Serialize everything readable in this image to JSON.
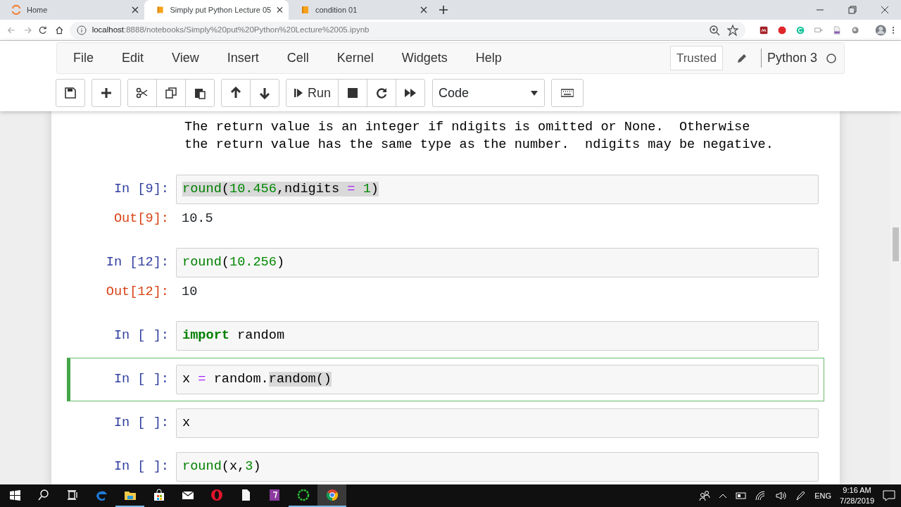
{
  "browser": {
    "tabs": [
      {
        "label": "Home",
        "selected": false
      },
      {
        "label": "Simply put Python Lecture 05",
        "selected": true
      },
      {
        "label": "condition 01",
        "selected": false
      }
    ],
    "address": {
      "host": "localhost",
      "path": ":8888/notebooks/Simply%20put%20Python%20Lecture%2005.ipynb"
    }
  },
  "jupyter": {
    "menu": [
      "File",
      "Edit",
      "View",
      "Insert",
      "Cell",
      "Kernel",
      "Widgets",
      "Help"
    ],
    "trusted": "Trusted",
    "kernel": "Python 3",
    "kernel_busy": false,
    "run_label": "Run",
    "cell_type": "Code"
  },
  "cells": [
    {
      "kind": "markdown",
      "lines": [
        "The return value is an integer if ndigits is omitted or None.  Otherwise",
        "the return value has the same type as the number.  ndigits may be negative."
      ]
    },
    {
      "kind": "code",
      "prompt": "In [9]:",
      "selected": false,
      "tokens": [
        {
          "text": "round",
          "kind": "builtin",
          "highlight": true
        },
        {
          "text": "(",
          "kind": "plain",
          "highlight": true
        },
        {
          "text": "10.456",
          "kind": "number",
          "highlight": true
        },
        {
          "text": ",ndigits ",
          "kind": "plain",
          "highlight": true
        },
        {
          "text": "=",
          "kind": "operator",
          "highlight": true
        },
        {
          "text": " 1",
          "kind": "number",
          "highlight": true
        },
        {
          "text": ")",
          "kind": "plain",
          "highlight": true
        }
      ],
      "output": {
        "prompt": "Out[9]:",
        "text": "10.5"
      }
    },
    {
      "kind": "code",
      "prompt": "In [12]:",
      "selected": false,
      "tokens": [
        {
          "text": "round",
          "kind": "builtin",
          "highlight": false
        },
        {
          "text": "(",
          "kind": "plain",
          "highlight": false
        },
        {
          "text": "10.256",
          "kind": "number",
          "highlight": false
        },
        {
          "text": ")",
          "kind": "plain",
          "highlight": false
        }
      ],
      "output": {
        "prompt": "Out[12]:",
        "text": "10"
      }
    },
    {
      "kind": "code",
      "prompt": "In [ ]:",
      "selected": false,
      "tokens": [
        {
          "text": "import",
          "kind": "keyword",
          "highlight": false
        },
        {
          "text": " random",
          "kind": "plain",
          "highlight": false
        }
      ]
    },
    {
      "kind": "code",
      "prompt": "In [ ]:",
      "selected": true,
      "tokens": [
        {
          "text": "x ",
          "kind": "plain",
          "highlight": false
        },
        {
          "text": "=",
          "kind": "operator",
          "highlight": false
        },
        {
          "text": " random.",
          "kind": "plain",
          "highlight": false
        },
        {
          "text": "random()",
          "kind": "plain",
          "highlight": true
        }
      ]
    },
    {
      "kind": "code",
      "prompt": "In [ ]:",
      "selected": false,
      "tokens": [
        {
          "text": "x",
          "kind": "plain",
          "highlight": false
        }
      ]
    },
    {
      "kind": "code",
      "prompt": "In [ ]:",
      "selected": false,
      "tokens": [
        {
          "text": "round",
          "kind": "builtin",
          "highlight": false
        },
        {
          "text": "(x,",
          "kind": "plain",
          "highlight": false
        },
        {
          "text": "3",
          "kind": "number",
          "highlight": false
        },
        {
          "text": ")",
          "kind": "plain",
          "highlight": false
        }
      ]
    }
  ],
  "taskbar": {
    "apps": [
      {
        "kind": "start",
        "running": false,
        "active": false
      },
      {
        "kind": "search",
        "running": false,
        "active": false
      },
      {
        "kind": "taskview",
        "running": false,
        "active": false
      },
      {
        "kind": "edge",
        "running": false,
        "active": false
      },
      {
        "kind": "explorer",
        "running": true,
        "active": false
      },
      {
        "kind": "store",
        "running": false,
        "active": false
      },
      {
        "kind": "mail",
        "running": false,
        "active": false
      },
      {
        "kind": "opera",
        "running": false,
        "active": false
      },
      {
        "kind": "file",
        "running": false,
        "active": false
      },
      {
        "kind": "pdf",
        "running": false,
        "active": false
      },
      {
        "kind": "ring",
        "running": true,
        "active": false
      },
      {
        "kind": "chrome",
        "running": true,
        "active": true
      }
    ],
    "language": "ENG",
    "time": "9:16 AM",
    "date": "7/28/2019"
  }
}
